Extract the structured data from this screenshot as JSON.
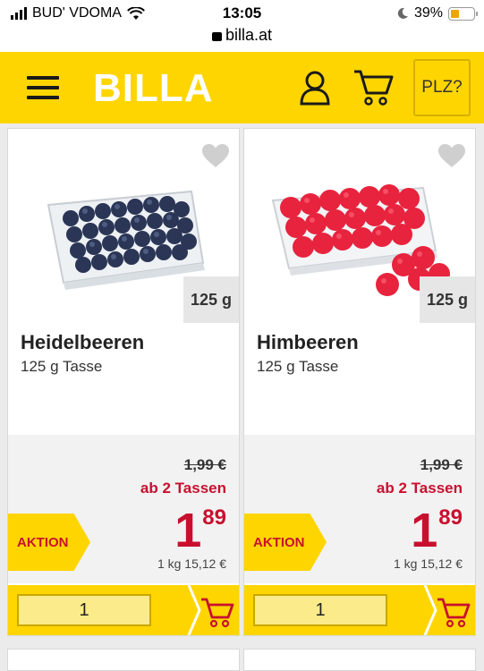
{
  "status_bar": {
    "carrier": "BUD' VDOMA",
    "time": "13:05",
    "url": "billa.at",
    "battery": "39%",
    "battery_level": 0.39
  },
  "header": {
    "logo": "BILLA",
    "plz_label": "PLZ?",
    "brand_color": "#ffd500",
    "icons": [
      "menu-icon",
      "user-icon",
      "cart-icon"
    ]
  },
  "products": [
    {
      "name": "Heidelbeeren",
      "description": "125 g Tasse",
      "weight_badge": "125 g",
      "old_price": "1,99 €",
      "promo_text": "ab 2 Tassen",
      "badge": "AKTION",
      "price_euros": "1",
      "price_cents": "89",
      "unit_price": "1 kg 15,12 €",
      "quantity": "1"
    },
    {
      "name": "Himbeeren",
      "description": "125 g Tasse",
      "weight_badge": "125 g",
      "old_price": "1,99 €",
      "promo_text": "ab 2 Tassen",
      "badge": "AKTION",
      "price_euros": "1",
      "price_cents": "89",
      "unit_price": "1 kg 15,12 €",
      "quantity": "1"
    }
  ],
  "colors": {
    "accent": "#ffd500",
    "sale_red": "#c8102e"
  }
}
